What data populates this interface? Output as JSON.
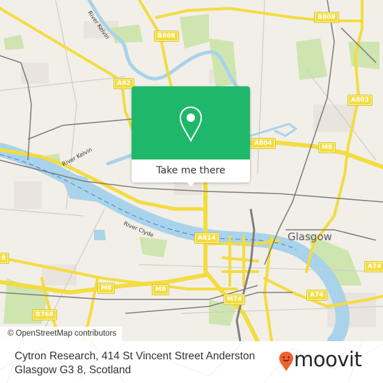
{
  "map": {
    "attribution": "© OpenStreetMap contributors",
    "city_label": "Glasgow",
    "colors": {
      "land": "#f2efe9",
      "park": "#cfe5b0",
      "water": "#a9d3ea",
      "road_major": "#f3dc3f",
      "road_minor": "#d8d4cc",
      "rail": "#7a7a7a"
    },
    "road_labels": [
      {
        "id": "a82",
        "text": "A82"
      },
      {
        "id": "b808-left",
        "text": "B808"
      },
      {
        "id": "b808-right",
        "text": "B808"
      },
      {
        "id": "a803",
        "text": "A803"
      },
      {
        "id": "a804",
        "text": "A804"
      },
      {
        "id": "m8-east",
        "text": "M8"
      },
      {
        "id": "a814",
        "text": "A814"
      },
      {
        "id": "m8-west",
        "text": "M8"
      },
      {
        "id": "m8-center",
        "text": "M8"
      },
      {
        "id": "m74",
        "text": "M74"
      },
      {
        "id": "a74-left",
        "text": "A74"
      },
      {
        "id": "a74-right",
        "text": "A74"
      },
      {
        "id": "b768",
        "text": "B768"
      },
      {
        "id": "a8-edge",
        "text": "8"
      }
    ],
    "river_labels": [
      {
        "id": "kelvin-north",
        "text": "River Kelvin"
      },
      {
        "id": "kelvin-south",
        "text": "River Kelvin"
      },
      {
        "id": "clyde",
        "text": "River Clyde"
      }
    ]
  },
  "popup": {
    "icon": "map-pin-icon",
    "button_label": "Take me there",
    "color": "#1fb86b"
  },
  "footer": {
    "address": "Cytron Research, 414 St Vincent Street Anderston Glasgow G3 8, Scotland",
    "brand": "moovit",
    "brand_color": "#f2622e"
  }
}
